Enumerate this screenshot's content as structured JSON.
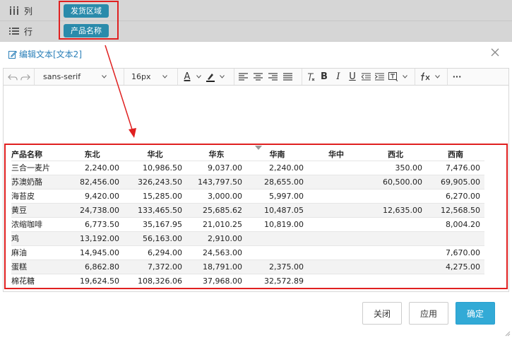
{
  "fields": {
    "columns_label": "列",
    "columns_chip": "发货区域",
    "rows_label": "行",
    "rows_chip": "产品名称"
  },
  "dialog": {
    "title": "编辑文本[文本2]"
  },
  "toolbar": {
    "font_family": "sans-serif",
    "font_size": "16px",
    "font_color_glyph": "A",
    "bold": "B",
    "italic": "I",
    "underline": "U",
    "more": "···"
  },
  "table": {
    "headers": [
      "产品名称",
      "东北",
      "华北",
      "华东",
      "华南",
      "华中",
      "西北",
      "西南"
    ],
    "rows": [
      [
        "三合一麦片",
        "2,240.00",
        "10,986.50",
        "9,037.00",
        "2,240.00",
        "",
        "350.00",
        "7,476.00"
      ],
      [
        "苏澳奶酪",
        "82,456.00",
        "326,243.50",
        "143,797.50",
        "28,655.00",
        "",
        "60,500.00",
        "69,905.00"
      ],
      [
        "海苔皮",
        "9,420.00",
        "15,285.00",
        "3,000.00",
        "5,997.00",
        "",
        "",
        "6,270.00"
      ],
      [
        "黄豆",
        "24,738.00",
        "133,465.50",
        "25,685.62",
        "10,487.05",
        "",
        "12,635.00",
        "12,568.50"
      ],
      [
        "浓缩咖啡",
        "6,773.50",
        "35,167.95",
        "21,010.25",
        "10,819.00",
        "",
        "",
        "8,004.20"
      ],
      [
        "鸡",
        "13,192.00",
        "56,163.00",
        "2,910.00",
        "",
        "",
        "",
        ""
      ],
      [
        "麻油",
        "14,945.00",
        "6,294.00",
        "24,563.00",
        "",
        "",
        "",
        "7,670.00"
      ],
      [
        "蛋糕",
        "6,862.80",
        "7,372.00",
        "18,791.00",
        "2,375.00",
        "",
        "",
        "4,275.00"
      ],
      [
        "棉花糖",
        "19,624.50",
        "108,326.06",
        "37,968.00",
        "32,572.89",
        "",
        "",
        ""
      ]
    ]
  },
  "buttons": {
    "close": "关闭",
    "apply": "应用",
    "ok": "确定"
  },
  "colors": {
    "chip": "#2a8bab",
    "highlight": "#e02020",
    "primary": "#32aad6",
    "title": "#2a7fb8"
  }
}
